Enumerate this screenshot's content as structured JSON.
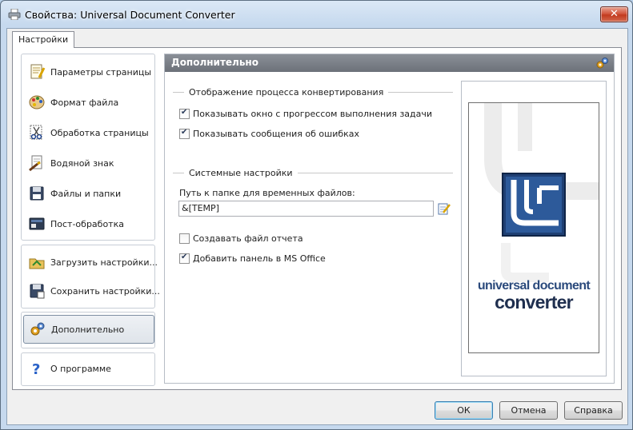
{
  "window": {
    "title": "Свойства: Universal Document Converter",
    "close_label": "✕"
  },
  "tabs": [
    {
      "label": "Настройки",
      "active": true
    }
  ],
  "sidebar": {
    "groups": [
      {
        "items": [
          {
            "label": "Параметры страницы",
            "icon": "page-settings-icon"
          },
          {
            "label": "Формат файла",
            "icon": "palette-icon"
          },
          {
            "label": "Обработка страницы",
            "icon": "scissors-icon"
          },
          {
            "label": "Водяной знак",
            "icon": "watermark-icon"
          },
          {
            "label": "Файлы и папки",
            "icon": "floppy-disk-icon"
          },
          {
            "label": "Пост-обработка",
            "icon": "post-processing-icon"
          }
        ]
      },
      {
        "items": [
          {
            "label": "Загрузить настройки...",
            "icon": "load-folder-icon"
          },
          {
            "label": "Сохранить настройки...",
            "icon": "save-settings-icon"
          }
        ]
      },
      {
        "items": [
          {
            "label": "Дополнительно",
            "icon": "gears-icon",
            "active": true
          }
        ]
      },
      {
        "items": [
          {
            "label": "О программе",
            "icon": "help-icon"
          }
        ]
      }
    ]
  },
  "content": {
    "title": "Дополнительно",
    "section_progress": {
      "title": "Отображение процесса конвертирования",
      "checkboxes": [
        {
          "label": "Показывать окно с прогрессом выполнения задачи",
          "checked": true
        },
        {
          "label": "Показывать сообщения об ошибках",
          "checked": true
        }
      ]
    },
    "section_system": {
      "title": "Системные настройки",
      "temp_label": "Путь к папке для временных файлов:",
      "temp_value": "&[TEMP]",
      "checkboxes": [
        {
          "label": "Создавать файл отчета",
          "checked": false
        },
        {
          "label": "Добавить панель в MS Office",
          "checked": true
        }
      ]
    },
    "logo": {
      "line1": "universal document",
      "line2": "converter"
    }
  },
  "buttons": {
    "ok": "ОК",
    "cancel": "Отмена",
    "help": "Справка"
  },
  "colors": {
    "header_bg": "#7a7f87",
    "logo_blue": "#2b4a7c",
    "close_red": "#c9452a"
  }
}
